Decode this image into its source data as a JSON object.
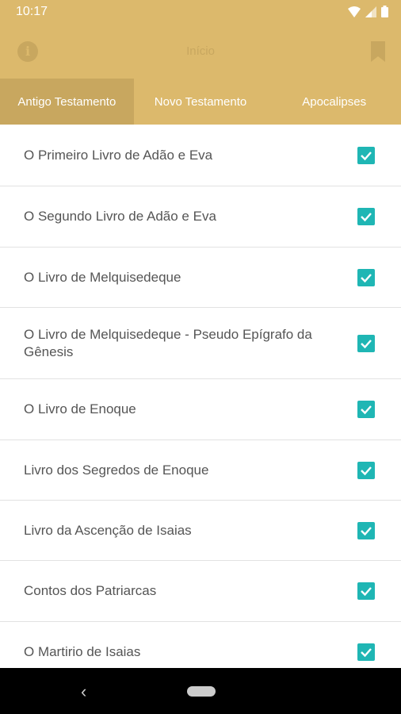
{
  "status_bar": {
    "time": "10:17"
  },
  "app_bar": {
    "title": "Início"
  },
  "tabs": [
    {
      "label": "Antigo Testamento"
    },
    {
      "label": "Novo Testamento"
    },
    {
      "label": "Apocalipses"
    }
  ],
  "books": [
    {
      "title": "O Primeiro Livro de Adão e Eva",
      "checked": true
    },
    {
      "title": "O Segundo Livro de Adão e Eva",
      "checked": true
    },
    {
      "title": "O Livro de Melquisedeque",
      "checked": true
    },
    {
      "title": "O Livro de Melquisedeque - Pseudo Epígrafo da Gênesis",
      "checked": true
    },
    {
      "title": "O Livro de Enoque",
      "checked": true
    },
    {
      "title": "Livro dos Segredos de Enoque",
      "checked": true
    },
    {
      "title": "Livro da Ascenção de Isaias",
      "checked": true
    },
    {
      "title": "Contos dos Patriarcas",
      "checked": true
    },
    {
      "title": "O Martirio de Isaias",
      "checked": true
    }
  ],
  "colors": {
    "accent": "#dcb96c",
    "accent_dark": "#c8a75f",
    "checkbox": "#1fb6b4"
  }
}
